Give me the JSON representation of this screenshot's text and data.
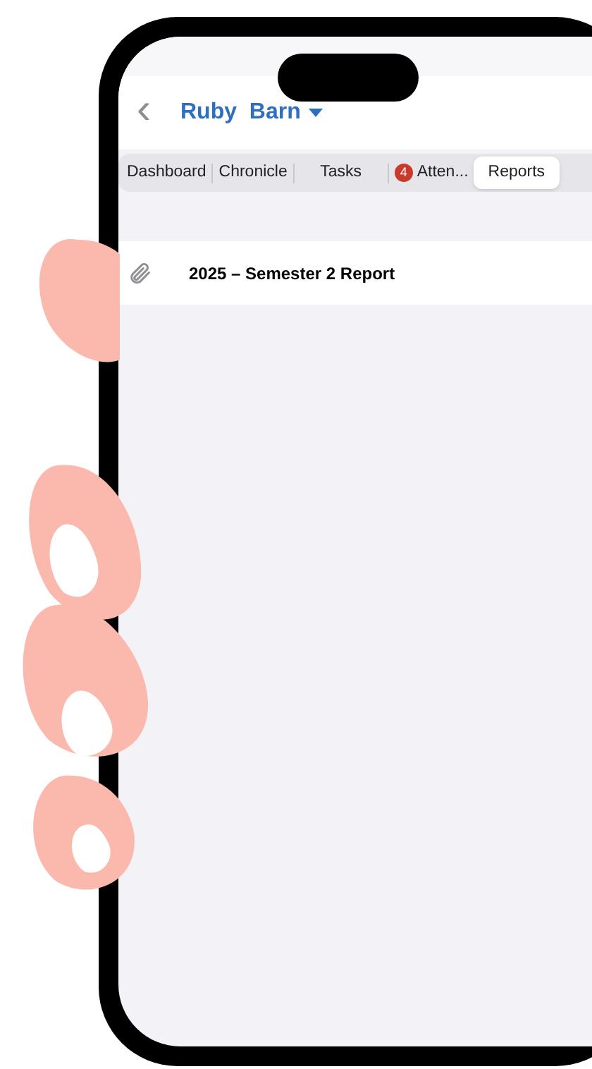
{
  "header": {
    "back": "‹",
    "title": "Ruby  Barn"
  },
  "tabs": [
    {
      "label": "Dashboard",
      "selected": false
    },
    {
      "label": "Chronicle",
      "selected": false
    },
    {
      "label": "Tasks",
      "selected": false
    },
    {
      "label": "Atten...",
      "selected": false,
      "badge": "4"
    },
    {
      "label": "Reports",
      "selected": true
    }
  ],
  "reports": [
    {
      "title": "2025 – Semester 2 Report"
    }
  ]
}
